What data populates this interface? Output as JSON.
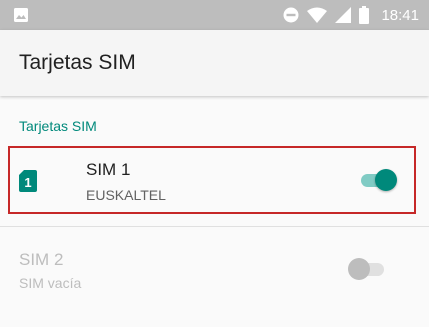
{
  "status_bar": {
    "time": "18:41",
    "icons": [
      "gallery-icon",
      "do-not-disturb-icon",
      "wifi-icon",
      "signal-icon",
      "battery-icon"
    ]
  },
  "app_bar": {
    "title": "Tarjetas SIM"
  },
  "section": {
    "header": "Tarjetas SIM"
  },
  "sims": [
    {
      "title": "SIM 1",
      "subtitle": "EUSKALTEL",
      "slot": "1",
      "enabled": true
    },
    {
      "title": "SIM 2",
      "subtitle": "SIM vacía",
      "enabled": false
    }
  ],
  "colors": {
    "accent": "#00897b",
    "highlight": "#c62828",
    "status_bar": "#bdbdbd"
  }
}
